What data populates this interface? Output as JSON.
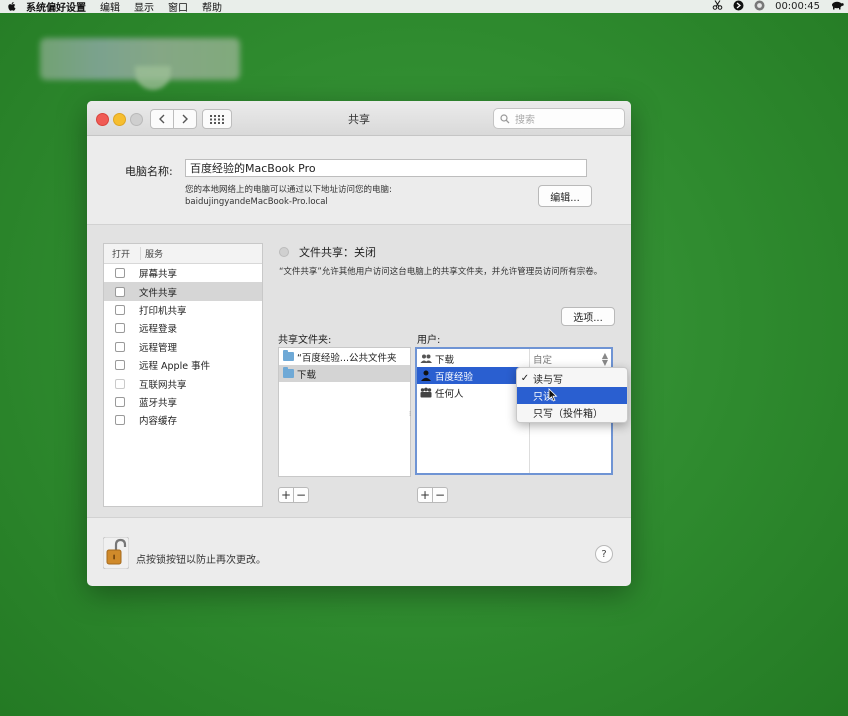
{
  "menubar": {
    "items": [
      "系统偏好设置",
      "编辑",
      "显示",
      "窗口",
      "帮助"
    ],
    "clock": "00:00:45"
  },
  "window": {
    "title": "共享",
    "search_placeholder": "搜索"
  },
  "computer_name": {
    "label": "电脑名称:",
    "value": "百度经验的MacBook Pro",
    "desc_line1": "您的本地网络上的电脑可以通过以下地址访问您的电脑:",
    "desc_line2": "baidujingyandeMacBook-Pro.local",
    "edit_button": "编辑..."
  },
  "services": {
    "header_on": "打开",
    "header_service": "服务",
    "items": [
      {
        "label": "屏幕共享",
        "selected": false
      },
      {
        "label": "文件共享",
        "selected": true
      },
      {
        "label": "打印机共享",
        "selected": false
      },
      {
        "label": "远程登录",
        "selected": false
      },
      {
        "label": "远程管理",
        "selected": false
      },
      {
        "label": "远程 Apple 事件",
        "selected": false
      },
      {
        "label": "互联网共享",
        "selected": false
      },
      {
        "label": "蓝牙共享",
        "selected": false
      },
      {
        "label": "内容缓存",
        "selected": false
      }
    ]
  },
  "file_sharing": {
    "status": "文件共享：关闭",
    "description": "“文件共享”允许其他用户访问这台电脑上的共享文件夹，并允许管理员访问所有宗卷。",
    "options_button": "选项...",
    "shared_folders_header": "共享文件夹:",
    "users_header": "用户:",
    "folders": [
      "“百度经验...公共文件夹",
      "下载"
    ],
    "users": [
      "下载",
      "百度经验",
      "任何人"
    ],
    "first_permission": "自定"
  },
  "permission_menu": {
    "items": [
      "读与写",
      "只读",
      "只写（投件箱）"
    ],
    "checked_index": 0,
    "highlighted_index": 1
  },
  "footer": {
    "lock_text": "点按锁按钮以防止再次更改。",
    "help": "?"
  },
  "colors": {
    "desktop": "#2e8a2e",
    "selection": "#2a5fd0"
  }
}
